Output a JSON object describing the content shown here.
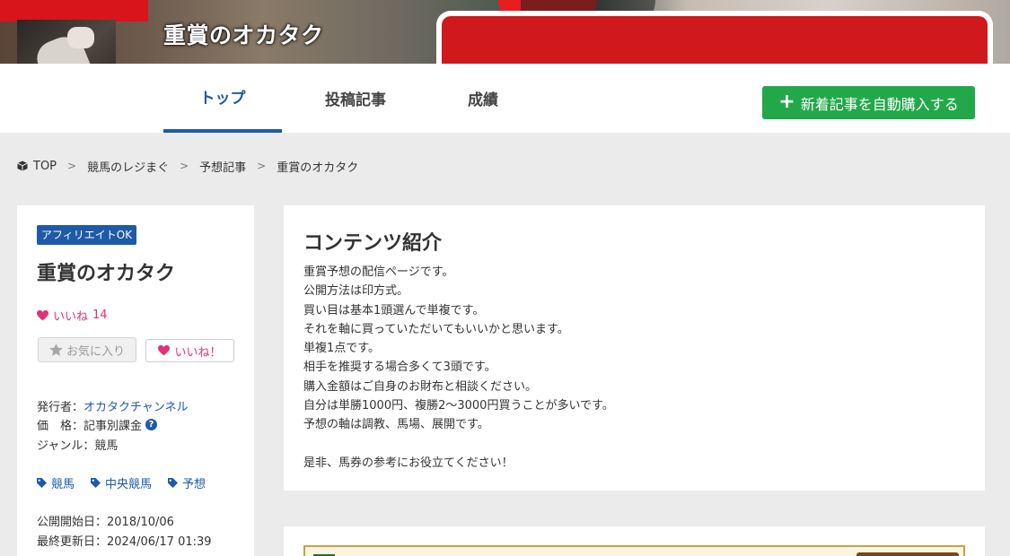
{
  "header": {
    "title": "重賞のオカタク",
    "tabs": [
      {
        "label": "トップ",
        "active": true
      },
      {
        "label": "投稿記事",
        "active": false
      },
      {
        "label": "成績",
        "active": false
      }
    ],
    "buy_button": {
      "icon": "plus-icon",
      "label": "新着記事を自動購入する"
    }
  },
  "breadcrumb": {
    "items": [
      "TOP",
      "競馬のレジまぐ",
      "予想記事",
      "重賞のオカタク"
    ]
  },
  "sidebar": {
    "badge": "アフィリエイトOK",
    "title": "重賞のオカタク",
    "like_label": "いいね",
    "like_count": "14",
    "favorite_button": "お気に入り",
    "like_button": "いいね！",
    "publisher_label": "発行者：",
    "publisher_value": "オカタクチャンネル",
    "price_label": "価　格：",
    "price_value": "記事別課金",
    "genre_label": "ジャンル：",
    "genre_value": "競馬",
    "tags": [
      "競馬",
      "中央競馬",
      "予想"
    ],
    "start_date_label": "公開開始日：",
    "start_date_value": "2018/10/06",
    "updated_label": "最終更新日：",
    "updated_value": "2024/06/17 01:39"
  },
  "content": {
    "heading": "コンテンツ紹介",
    "lines": [
      "重賞予想の配信ページです。",
      "公開方法は印方式。",
      "買い目は基本1頭選んで単複です。",
      "それを軸に買っていただいてもいいかと思います。",
      "単複1点です。",
      "相手を推奨する場合多くて3頭です。",
      "購入金額はご自身のお財布と相談ください。",
      "自分は単勝1000円、複勝2～3000円買うことが多いです。",
      "予想の軸は調教、馬場、展開です。",
      "",
      "是非、馬券の参考にお役立てください！"
    ]
  },
  "colors": {
    "accent_blue": "#1e5aa8",
    "buy_green": "#22a84a",
    "like_pink": "#e0327a",
    "background": "#ebebeb"
  }
}
